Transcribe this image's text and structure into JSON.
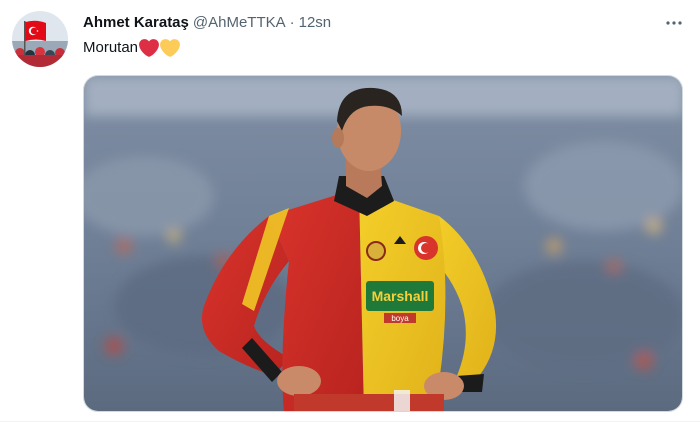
{
  "tweet": {
    "author": {
      "display_name": "Ahmet Karataş",
      "handle": "@AhMeTTKA",
      "avatar_icon": "turkish-flag-crowd-avatar"
    },
    "separator": "·",
    "timestamp": "12sn",
    "text": "Morutan",
    "emojis": [
      "red-heart-icon",
      "yellow-heart-icon"
    ],
    "more_icon": "more-options-icon",
    "media": {
      "type": "photo",
      "jersey_sponsor": "Marshall",
      "jersey_sponsor_sub": "boya"
    }
  },
  "colors": {
    "text_primary": "#0f1419",
    "text_secondary": "#536471",
    "border": "#cfd9de",
    "heart_red": "#f91f3e",
    "heart_yellow": "#ffcc4d"
  }
}
